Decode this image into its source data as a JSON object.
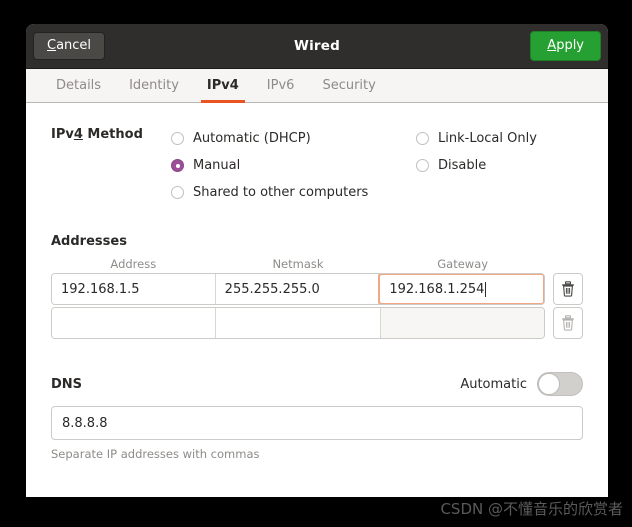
{
  "window": {
    "title": "Wired",
    "cancel_label": "Cancel",
    "apply_label": "Apply"
  },
  "tabs": [
    {
      "label": "Details",
      "active": false
    },
    {
      "label": "Identity",
      "active": false
    },
    {
      "label": "IPv4",
      "active": true
    },
    {
      "label": "IPv6",
      "active": false
    },
    {
      "label": "Security",
      "active": false
    }
  ],
  "method": {
    "label": "IPv4 Method",
    "options_left": [
      {
        "label": "Automatic (DHCP)",
        "selected": false
      },
      {
        "label": "Manual",
        "selected": true
      },
      {
        "label": "Shared to other computers",
        "selected": false
      }
    ],
    "options_right": [
      {
        "label": "Link-Local Only",
        "selected": false
      },
      {
        "label": "Disable",
        "selected": false
      }
    ]
  },
  "addresses": {
    "heading": "Addresses",
    "columns": [
      "Address",
      "Netmask",
      "Gateway"
    ],
    "rows": [
      {
        "address": "192.168.1.5",
        "netmask": "255.255.255.0",
        "gateway": "192.168.1.254",
        "focused_field": "gateway",
        "delete_enabled": true
      },
      {
        "address": "",
        "netmask": "",
        "gateway": "",
        "focused_field": "",
        "delete_enabled": false
      }
    ],
    "delete_icon": "trash-icon"
  },
  "dns": {
    "heading": "DNS",
    "automatic_label": "Automatic",
    "automatic_enabled": false,
    "value": "8.8.8.8",
    "hint": "Separate IP addresses with commas"
  },
  "watermark": {
    "text": "CSDN @不懂音乐的欣赏者"
  },
  "colors": {
    "accent_orange": "#e95420",
    "apply_green": "#26a032",
    "radio_purple": "#9b4f96",
    "titlebar": "#302e2c",
    "focus_border": "#f0a882"
  }
}
